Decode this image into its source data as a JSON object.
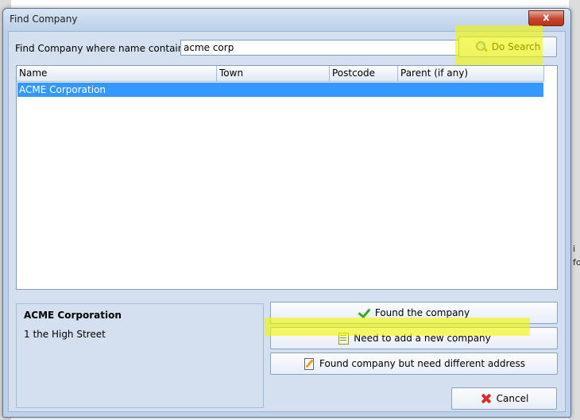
{
  "window": {
    "title": "Find Company",
    "close_symbol": "x"
  },
  "search": {
    "label": "Find Company where name contains",
    "value": "acme corp",
    "button_label": "Do Search",
    "button_icon": "magnifier-icon"
  },
  "grid": {
    "columns": [
      "Name",
      "Town",
      "Postcode",
      "Parent (if any)"
    ],
    "rows": [
      {
        "name": "ACME Corporation",
        "town": "",
        "postcode": "",
        "parent": "",
        "selected": true
      }
    ]
  },
  "details": {
    "name": "ACME Corporation",
    "address": "1 the High Street"
  },
  "actions": {
    "found": {
      "label": "Found the company",
      "icon": "check-icon"
    },
    "add": {
      "label": "Need to add a new company",
      "icon": "notepad-icon"
    },
    "different_address": {
      "label": "Found company but need different address",
      "icon": "edit-document-icon"
    },
    "cancel": {
      "label": "Cancel",
      "icon": "red-cross-icon"
    }
  },
  "background_peek": {
    "line1": "i",
    "line2": "fo"
  },
  "colors": {
    "selection": "#3399ff",
    "highlight": "#f2f700",
    "dialog_bg": "#d4e0f0"
  }
}
